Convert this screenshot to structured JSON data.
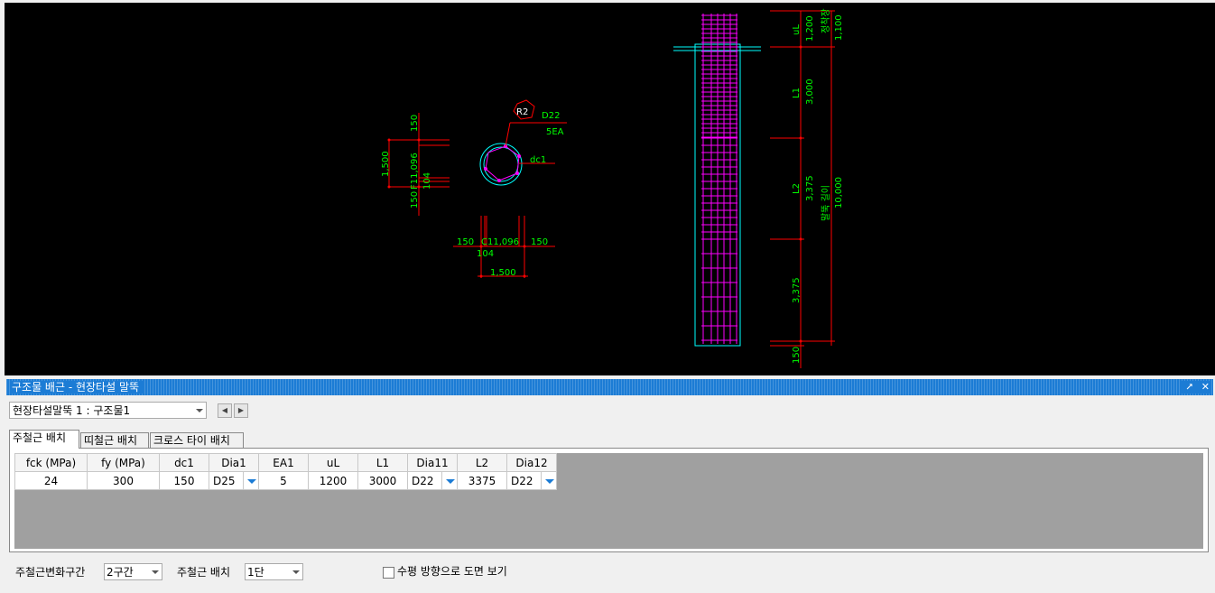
{
  "cad": {
    "section": {
      "r2_tag": "R2",
      "bar_dia": "D22",
      "bar_count": "5EA",
      "dc_label": "dc1",
      "left_dims": [
        "150",
        "1,500",
        "F11,096",
        "104",
        "150"
      ],
      "bottom_dims": [
        "150",
        "C11,096",
        "150",
        "104",
        "1,500"
      ]
    },
    "elevation": {
      "labels": [
        "uL",
        "1,200",
        "정착장",
        "1,100",
        "L1",
        "3,000",
        "L2",
        "3,375",
        "말뚝 길이",
        "10,000",
        "3,375",
        "150"
      ]
    }
  },
  "panel": {
    "title": "구조물 배근 - 현장타설 말뚝",
    "pin_icon": "pin-icon",
    "close_icon": "close-icon",
    "object_select": "현장타설말뚝 1 : 구조물1",
    "prev_button": "◀",
    "next_button": "▶"
  },
  "tabs": [
    "주철근 배치",
    "띠철근 배치",
    "크로스 타이 배치"
  ],
  "grid": {
    "headers": [
      "fck (MPa)",
      "fy (MPa)",
      "dc1",
      "Dia1",
      "EA1",
      "uL",
      "L1",
      "Dia11",
      "L2",
      "Dia12"
    ],
    "row": [
      "24",
      "300",
      "150",
      "D25",
      "5",
      "1200",
      "3000",
      "D22",
      "3375",
      "D22"
    ]
  },
  "bottom": {
    "section_label": "주철근변화구간",
    "section_value": "2구간",
    "layout_label": "주철근 배치",
    "layout_value": "1단",
    "horizontal_label": "수평 방향으로 도면 보기"
  },
  "colors": {
    "dim": "#ff0000",
    "text": "#00ff00",
    "rebar": "#ff00ff",
    "outline": "#00ffff",
    "title_bar": "#1c7cd5"
  }
}
